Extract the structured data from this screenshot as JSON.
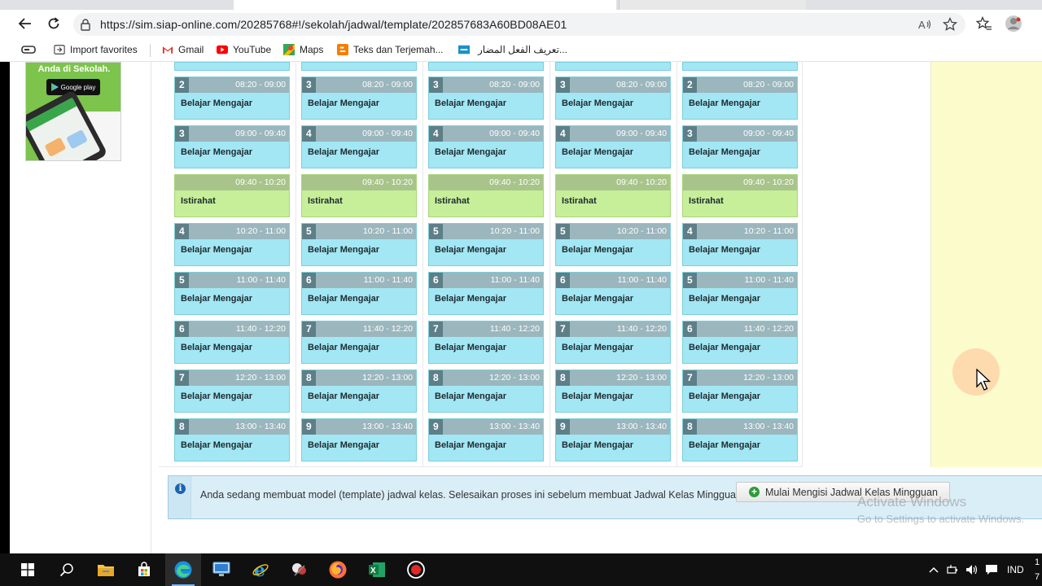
{
  "browser": {
    "url": "https://sim.siap-online.com/20285768#!/sekolah/jadwal/template/202857683A60BD08AE01",
    "bookmarks": [
      {
        "label": "Import favorites",
        "icon": "import-icon"
      },
      {
        "label": "Gmail",
        "icon": "gmail-icon"
      },
      {
        "label": "YouTube",
        "icon": "youtube-icon"
      },
      {
        "label": "Maps",
        "icon": "maps-icon"
      },
      {
        "label": "Teks dan Terjemah...",
        "icon": "blogger-icon"
      },
      {
        "label": "تعريف الفعل المضار...",
        "icon": "site-icon"
      }
    ]
  },
  "ad": {
    "tagline": "Anda di Sekolah.",
    "store_label": "Google play"
  },
  "schedule": {
    "columns": [
      {
        "slots": [
          {
            "num": "2",
            "time": "08:20 - 09:00",
            "label": "Belajar Mengajar"
          },
          {
            "num": "3",
            "time": "09:00 - 09:40",
            "label": "Belajar Mengajar"
          },
          {
            "num": "",
            "time": "09:40 - 10:20",
            "label": "Istirahat",
            "break": true
          },
          {
            "num": "4",
            "time": "10:20 - 11:00",
            "label": "Belajar Mengajar"
          },
          {
            "num": "5",
            "time": "11:00 - 11:40",
            "label": "Belajar Mengajar"
          },
          {
            "num": "6",
            "time": "11:40 - 12:20",
            "label": "Belajar Mengajar"
          },
          {
            "num": "7",
            "time": "12:20 - 13:00",
            "label": "Belajar Mengajar"
          },
          {
            "num": "8",
            "time": "13:00 - 13:40",
            "label": "Belajar Mengajar"
          }
        ]
      },
      {
        "slots": [
          {
            "num": "3",
            "time": "08:20 - 09:00",
            "label": "Belajar Mengajar"
          },
          {
            "num": "4",
            "time": "09:00 - 09:40",
            "label": "Belajar Mengajar"
          },
          {
            "num": "",
            "time": "09:40 - 10:20",
            "label": "Istirahat",
            "break": true
          },
          {
            "num": "5",
            "time": "10:20 - 11:00",
            "label": "Belajar Mengajar"
          },
          {
            "num": "6",
            "time": "11:00 - 11:40",
            "label": "Belajar Mengajar"
          },
          {
            "num": "7",
            "time": "11:40 - 12:20",
            "label": "Belajar Mengajar"
          },
          {
            "num": "8",
            "time": "12:20 - 13:00",
            "label": "Belajar Mengajar"
          },
          {
            "num": "9",
            "time": "13:00 - 13:40",
            "label": "Belajar Mengajar"
          }
        ]
      },
      {
        "slots": [
          {
            "num": "3",
            "time": "08:20 - 09:00",
            "label": "Belajar Mengajar"
          },
          {
            "num": "4",
            "time": "09:00 - 09:40",
            "label": "Belajar Mengajar"
          },
          {
            "num": "",
            "time": "09:40 - 10:20",
            "label": "Istirahat",
            "break": true
          },
          {
            "num": "5",
            "time": "10:20 - 11:00",
            "label": "Belajar Mengajar"
          },
          {
            "num": "6",
            "time": "11:00 - 11:40",
            "label": "Belajar Mengajar"
          },
          {
            "num": "7",
            "time": "11:40 - 12:20",
            "label": "Belajar Mengajar"
          },
          {
            "num": "8",
            "time": "12:20 - 13:00",
            "label": "Belajar Mengajar"
          },
          {
            "num": "9",
            "time": "13:00 - 13:40",
            "label": "Belajar Mengajar"
          }
        ]
      },
      {
        "slots": [
          {
            "num": "3",
            "time": "08:20 - 09:00",
            "label": "Belajar Mengajar"
          },
          {
            "num": "4",
            "time": "09:00 - 09:40",
            "label": "Belajar Mengajar"
          },
          {
            "num": "",
            "time": "09:40 - 10:20",
            "label": "Istirahat",
            "break": true
          },
          {
            "num": "5",
            "time": "10:20 - 11:00",
            "label": "Belajar Mengajar"
          },
          {
            "num": "6",
            "time": "11:00 - 11:40",
            "label": "Belajar Mengajar"
          },
          {
            "num": "7",
            "time": "11:40 - 12:20",
            "label": "Belajar Mengajar"
          },
          {
            "num": "8",
            "time": "12:20 - 13:00",
            "label": "Belajar Mengajar"
          },
          {
            "num": "9",
            "time": "13:00 - 13:40",
            "label": "Belajar Mengajar"
          }
        ]
      },
      {
        "slots": [
          {
            "num": "2",
            "time": "08:20 - 09:00",
            "label": "Belajar Mengajar"
          },
          {
            "num": "3",
            "time": "09:00 - 09:40",
            "label": "Belajar Mengajar"
          },
          {
            "num": "",
            "time": "09:40 - 10:20",
            "label": "Istirahat",
            "break": true
          },
          {
            "num": "4",
            "time": "10:20 - 11:00",
            "label": "Belajar Mengajar"
          },
          {
            "num": "5",
            "time": "11:00 - 11:40",
            "label": "Belajar Mengajar"
          },
          {
            "num": "6",
            "time": "11:40 - 12:20",
            "label": "Belajar Mengajar"
          },
          {
            "num": "7",
            "time": "12:20 - 13:00",
            "label": "Belajar Mengajar"
          },
          {
            "num": "8",
            "time": "13:00 - 13:40",
            "label": "Belajar Mengajar"
          }
        ]
      }
    ]
  },
  "info": {
    "message": "Anda sedang membuat model (template) jadwal kelas. Selesaikan proses ini sebelum membuat Jadwal Kelas Mingguan.",
    "button_label": "Mulai Mengisi Jadwal Kelas Mingguan"
  },
  "watermark": {
    "line1": "Activate Windows",
    "line2": "Go to Settings to activate Windows."
  },
  "taskbar": {
    "apps": [
      "windows-start-icon",
      "search-icon",
      "file-explorer-icon",
      "store-icon",
      "edge-icon",
      "remote-desktop-icon",
      "ie-icon",
      "snipping-tool-icon",
      "firefox-icon",
      "excel-icon",
      "record-icon"
    ],
    "language": "IND",
    "clock": "1 7"
  },
  "colors": {
    "slot_bg": "#a2e7f3",
    "slot_header": "#9bb6bd",
    "break_bg": "#c7ef9a",
    "info_bg": "#daeef8",
    "yellow_panel": "#fcfbcc"
  }
}
